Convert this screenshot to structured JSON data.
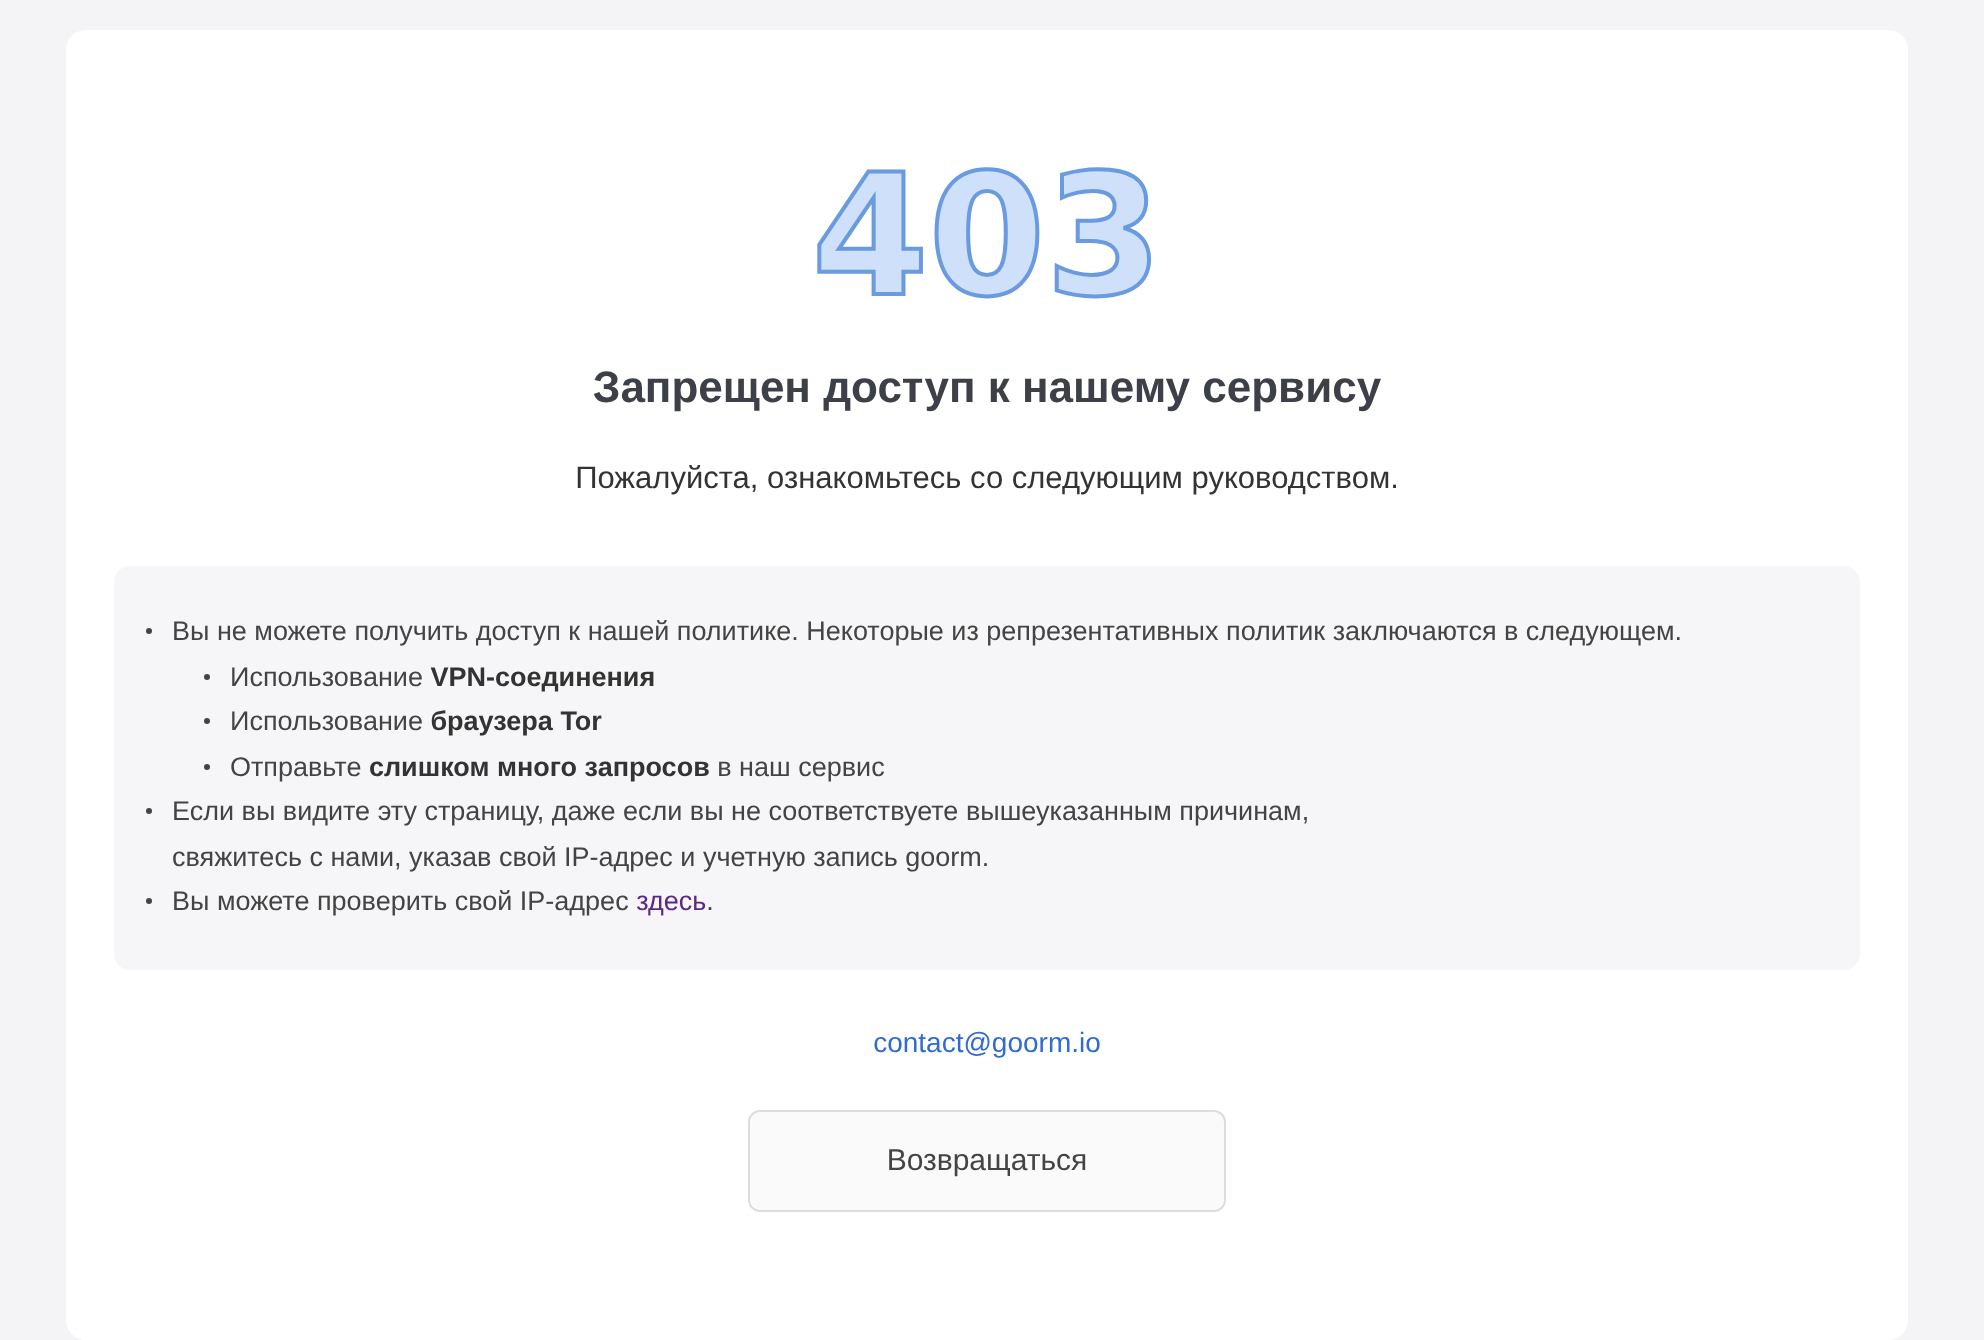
{
  "error_code": "403",
  "title": "Запрещен доступ к нашему сервису",
  "subtitle": "Пожалуйста, ознакомьтесь со следующим руководством.",
  "notice": [
    {
      "kind": "text",
      "text": "Вы не можете получить доступ к нашей политике. Некоторые из репрезентативных политик заключаются в следующем.",
      "children": [
        {
          "kind": "text",
          "text": "Использование **VPN-соединения**"
        },
        {
          "kind": "text",
          "text": "Использование **браузера Tor**"
        },
        {
          "kind": "text",
          "text": "Отправьте **слишком много запросов** в наш сервис"
        }
      ]
    },
    {
      "kind": "text",
      "text": "Если вы видите эту страницу, даже если вы не соответствуете вышеуказанным причинам,\nсвяжитесь с нами, указав свой IP-адрес и учетную запись goorm."
    },
    {
      "kind": "link",
      "before": "Вы можете проверить свой IP-адрес ",
      "link": "здесь",
      "after": "."
    }
  ],
  "contact_email": "contact@goorm.io",
  "back_button": "Возвращаться"
}
